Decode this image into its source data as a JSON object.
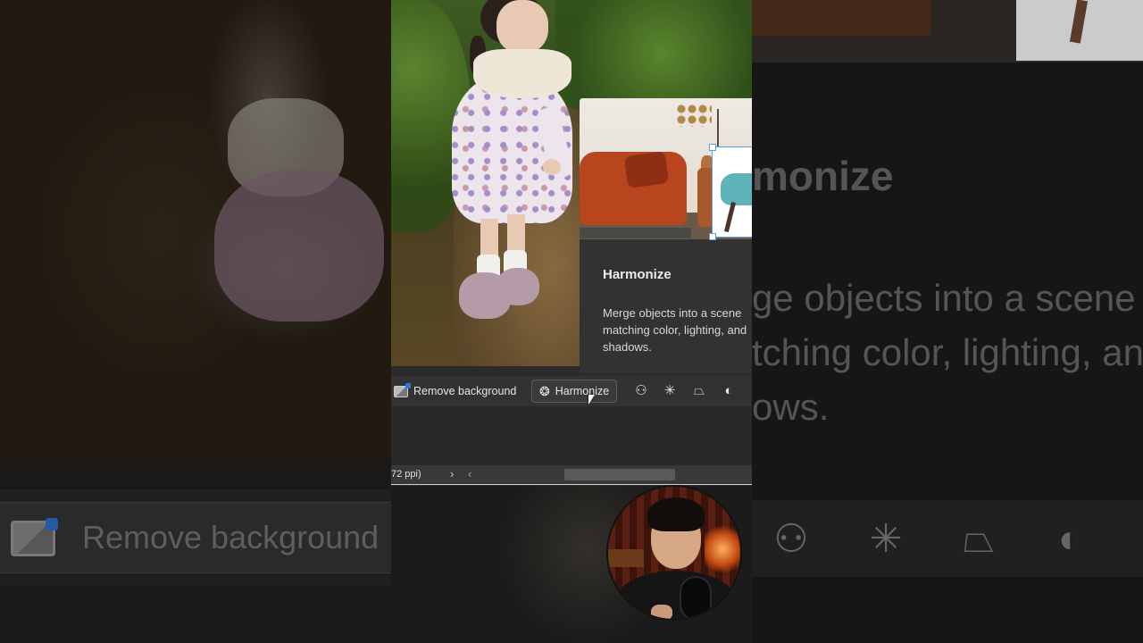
{
  "tooltip": {
    "title": "Harmonize",
    "description": "Merge objects into a scene matching color, lighting, and shadows."
  },
  "taskbar": {
    "remove_background_label": "Remove background",
    "harmonize_label": "Harmonize",
    "icons": [
      "person-group-icon",
      "sparkle-select-icon",
      "polygon-lasso-icon",
      "contrast-icon"
    ]
  },
  "statusbar": {
    "zoom_text": "72 ppi)",
    "next_arrow": "›",
    "prev_arrow": "‹"
  },
  "background_zoom": {
    "title_fragment": "monize",
    "desc_line1": "ge objects into a scene",
    "desc_line2": "tching color, lighting, an",
    "desc_line3": "ows.",
    "remove_background_label": "Remove background"
  },
  "colors": {
    "panel": "#323232",
    "accent_blue": "#2a7ae2",
    "selection_blue": "#5aa0e6"
  }
}
